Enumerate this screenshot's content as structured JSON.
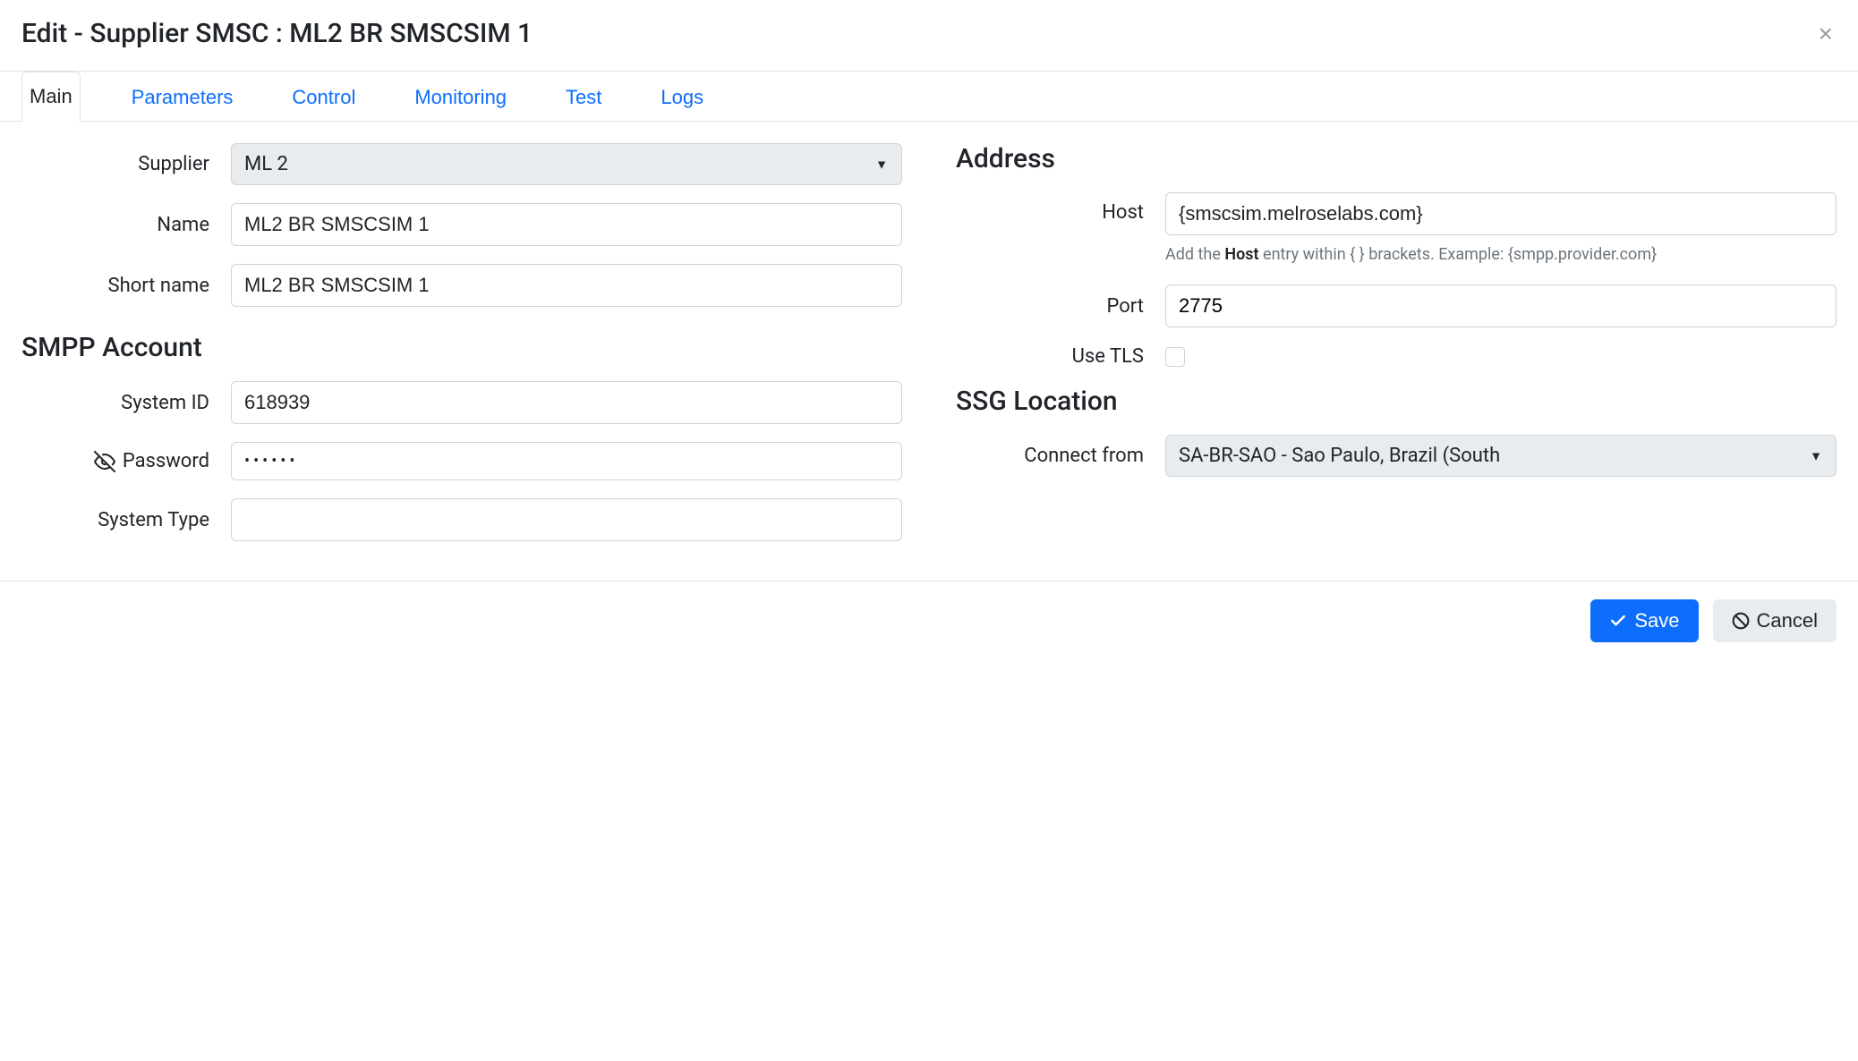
{
  "header": {
    "title": "Edit - Supplier SMSC : ML2 BR SMSCSIM 1"
  },
  "tabs": [
    {
      "label": "Main",
      "active": true
    },
    {
      "label": "Parameters",
      "active": false
    },
    {
      "label": "Control",
      "active": false
    },
    {
      "label": "Monitoring",
      "active": false
    },
    {
      "label": "Test",
      "active": false
    },
    {
      "label": "Logs",
      "active": false
    }
  ],
  "left": {
    "supplier_label": "Supplier",
    "supplier_value": "ML 2",
    "name_label": "Name",
    "name_value": "ML2 BR SMSCSIM 1",
    "shortname_label": "Short name",
    "shortname_value": "ML2 BR SMSCSIM 1",
    "smpp_heading": "SMPP Account",
    "systemid_label": "System ID",
    "systemid_value": "618939",
    "password_label": "Password",
    "password_value": "••••••",
    "systemtype_label": "System Type",
    "systemtype_value": ""
  },
  "right": {
    "address_heading": "Address",
    "host_label": "Host",
    "host_value": "{smscsim.melroselabs.com}",
    "host_help_prefix": "Add the ",
    "host_help_bold": "Host",
    "host_help_suffix": " entry within { } brackets. Example: {smpp.provider.com}",
    "port_label": "Port",
    "port_value": "2775",
    "usetls_label": "Use TLS",
    "ssg_heading": "SSG Location",
    "connectfrom_label": "Connect from",
    "connectfrom_value": "SA-BR-SAO - Sao Paulo, Brazil (South"
  },
  "footer": {
    "save_label": "Save",
    "cancel_label": "Cancel"
  }
}
